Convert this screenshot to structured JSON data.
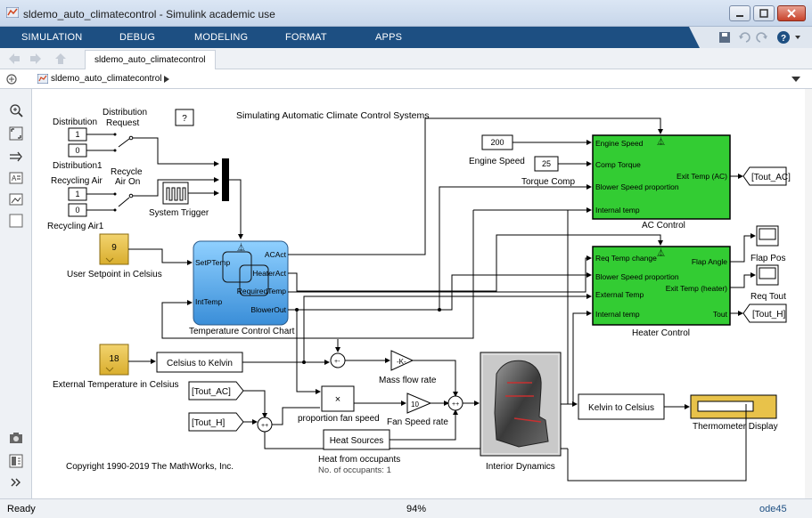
{
  "window": {
    "title": "sldemo_auto_climatecontrol - Simulink academic use"
  },
  "menu": {
    "items": [
      "SIMULATION",
      "DEBUG",
      "MODELING",
      "FORMAT",
      "APPS"
    ]
  },
  "tab": {
    "label": "sldemo_auto_climatecontrol"
  },
  "address": {
    "path": "sldemo_auto_climatecontrol"
  },
  "model": {
    "title": "Simulating Automatic Climate Control Systems",
    "copyright": "Copyright 1990-2019 The MathWorks, Inc.",
    "help_button": "?",
    "distribution": {
      "label": "Distribution",
      "request_label": "Distribution\nRequest",
      "const1": "1",
      "const0": "0",
      "name": "Distribution1"
    },
    "recycling": {
      "label": "Recycling Air",
      "on_label": "Recycle\nAir On",
      "const1": "1",
      "const0": "0",
      "name": "Recycling Air1"
    },
    "system_trigger": "System Trigger",
    "user_setpoint": {
      "value": "9",
      "label": "User Setpoint in Celsius"
    },
    "external_temp": {
      "value": "18",
      "label": "External Temperature in Celsius"
    },
    "chart": {
      "label": "Temperature Control Chart",
      "ports_in": [
        "SetPTemp",
        "IntTemp"
      ],
      "ports_out": [
        "ACAct",
        "HeaterAct",
        "RequiredTemp",
        "BlowerOut"
      ]
    },
    "engine_speed": {
      "value": "200",
      "label": "Engine Speed"
    },
    "torque_comp": {
      "value": "25",
      "label": "Torque Comp"
    },
    "ac_control": {
      "label": "AC Control",
      "ports_in": [
        "Engine Speed",
        "Comp Torque",
        "Blower Speed proportion",
        "Internal temp"
      ],
      "ports_out": [
        "Exit Temp (AC)"
      ]
    },
    "heater_control": {
      "label": "Heater Control",
      "ports_in": [
        "Req Temp change",
        "Blower Speed proportion",
        "External Temp",
        "Internal temp"
      ],
      "ports_out": [
        "Flap Angle",
        "Exit Temp (heater)",
        "Tout"
      ]
    },
    "goto_ac": "[Tout_AC]",
    "goto_h": "[Tout_H]",
    "from_ac": "[Tout_AC]",
    "from_h": "[Tout_H]",
    "flap_pos": "Flap Pos",
    "req_tout": "Req Tout",
    "celsius_to_kelvin": "Celsius to Kelvin",
    "kelvin_to_celsius": "Kelvin to Celsius",
    "gain_k": "-K-",
    "mass_flow_rate": "Mass flow rate",
    "product_symbol": "×",
    "proportion_fan_speed": "proportion fan speed",
    "gain_10": "10",
    "fan_speed_rate": "Fan Speed rate",
    "heat_sources": "Heat Sources",
    "heat_from_occupants": "Heat from occupants",
    "occupants": "No. of occupants: 1",
    "interior_dynamics": "Interior Dynamics",
    "thermometer": "Thermometer Display"
  },
  "status": {
    "left": "Ready",
    "zoom": "94%",
    "solver": "ode45"
  },
  "colors": {
    "menu_bg": "#1d4f82",
    "green_block": "#33cc33",
    "chart_blue": "#4a9fdf",
    "const_gold": "#e8c24a"
  }
}
